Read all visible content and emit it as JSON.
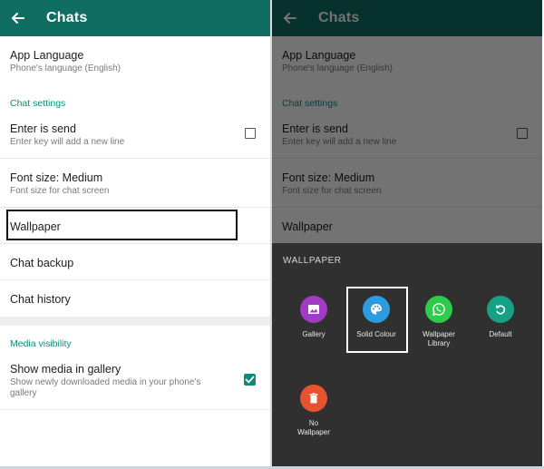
{
  "colors": {
    "toolbar": "#0f6d62",
    "accent": "#0b8f7a",
    "sheet_bg": "#303030",
    "gallery": "#a03cc4",
    "solid_colour": "#2d9be0",
    "wallpaper_library": "#2ecc4b",
    "default": "#16a085",
    "no_wallpaper": "#e8532f"
  },
  "toolbar": {
    "title": "Chats",
    "back_icon": "arrow-left-icon"
  },
  "settings": {
    "app_language": {
      "title": "App Language",
      "subtitle": "Phone's language (English)"
    },
    "chat_settings_header": "Chat settings",
    "enter_is_send": {
      "title": "Enter is send",
      "subtitle": "Enter key will add a new line",
      "checked": false
    },
    "font_size": {
      "title": "Font size: Medium",
      "subtitle": "Font size for chat screen"
    },
    "wallpaper": {
      "title": "Wallpaper"
    },
    "chat_backup": {
      "title": "Chat backup"
    },
    "chat_history": {
      "title": "Chat history"
    },
    "media_visibility_header": "Media visibility",
    "show_media": {
      "title": "Show media in gallery",
      "subtitle_line1": "Show newly downloaded media in your phone's",
      "subtitle_line2": "gallery",
      "checked": true
    }
  },
  "wallpaper_sheet": {
    "title": "WALLPAPER",
    "options": [
      {
        "label": "Gallery",
        "icon": "image-icon"
      },
      {
        "label": "Solid Colour",
        "icon": "palette-icon"
      },
      {
        "label_line1": "Wallpaper",
        "label_line2": "Library",
        "icon": "whatsapp-icon"
      },
      {
        "label": "Default",
        "icon": "reset-icon"
      },
      {
        "label_line1": "No",
        "label_line2": "Wallpaper",
        "icon": "trash-icon"
      }
    ]
  }
}
